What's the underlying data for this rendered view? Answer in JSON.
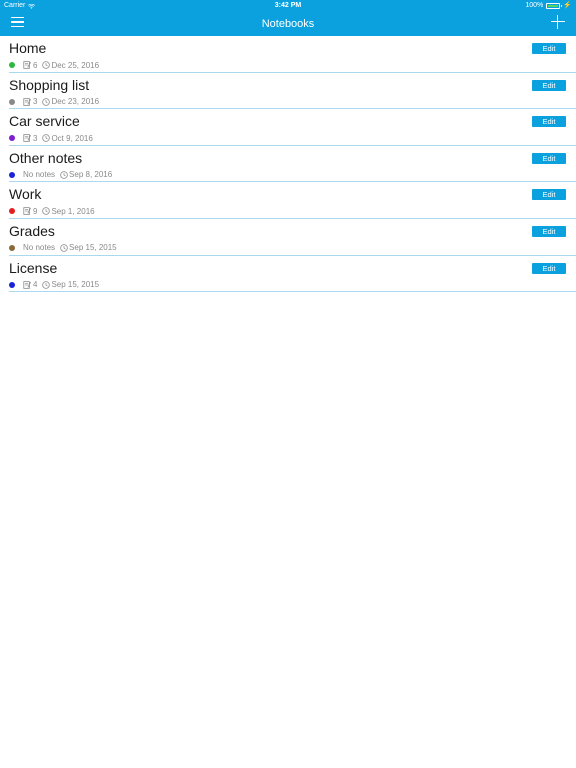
{
  "status_bar": {
    "carrier": "Carrier",
    "time": "3:42 PM",
    "battery": "100%"
  },
  "nav": {
    "title": "Notebooks"
  },
  "notebooks": [
    {
      "title": "Home",
      "color": "#2db843",
      "note_count": "6",
      "date": "Dec 25, 2016",
      "edit_label": "Edit"
    },
    {
      "title": "Shopping list",
      "color": "#888888",
      "note_count": "3",
      "date": "Dec 23, 2016",
      "edit_label": "Edit"
    },
    {
      "title": "Car service",
      "color": "#7b1fd1",
      "note_count": "3",
      "date": "Oct 9, 2016",
      "edit_label": "Edit"
    },
    {
      "title": "Other notes",
      "color": "#1a23d6",
      "note_count": "No notes",
      "date": "Sep 8, 2016",
      "edit_label": "Edit"
    },
    {
      "title": "Work",
      "color": "#e31e1e",
      "note_count": "9",
      "date": "Sep 1, 2016",
      "edit_label": "Edit"
    },
    {
      "title": "Grades",
      "color": "#8a6a3a",
      "note_count": "No notes",
      "date": "Sep 15, 2015",
      "edit_label": "Edit"
    },
    {
      "title": "License",
      "color": "#1a23d6",
      "note_count": "4",
      "date": "Sep 15, 2015",
      "edit_label": "Edit"
    }
  ],
  "colors": {
    "accent": "#0aa1de",
    "separator": "#a9d9ee"
  }
}
